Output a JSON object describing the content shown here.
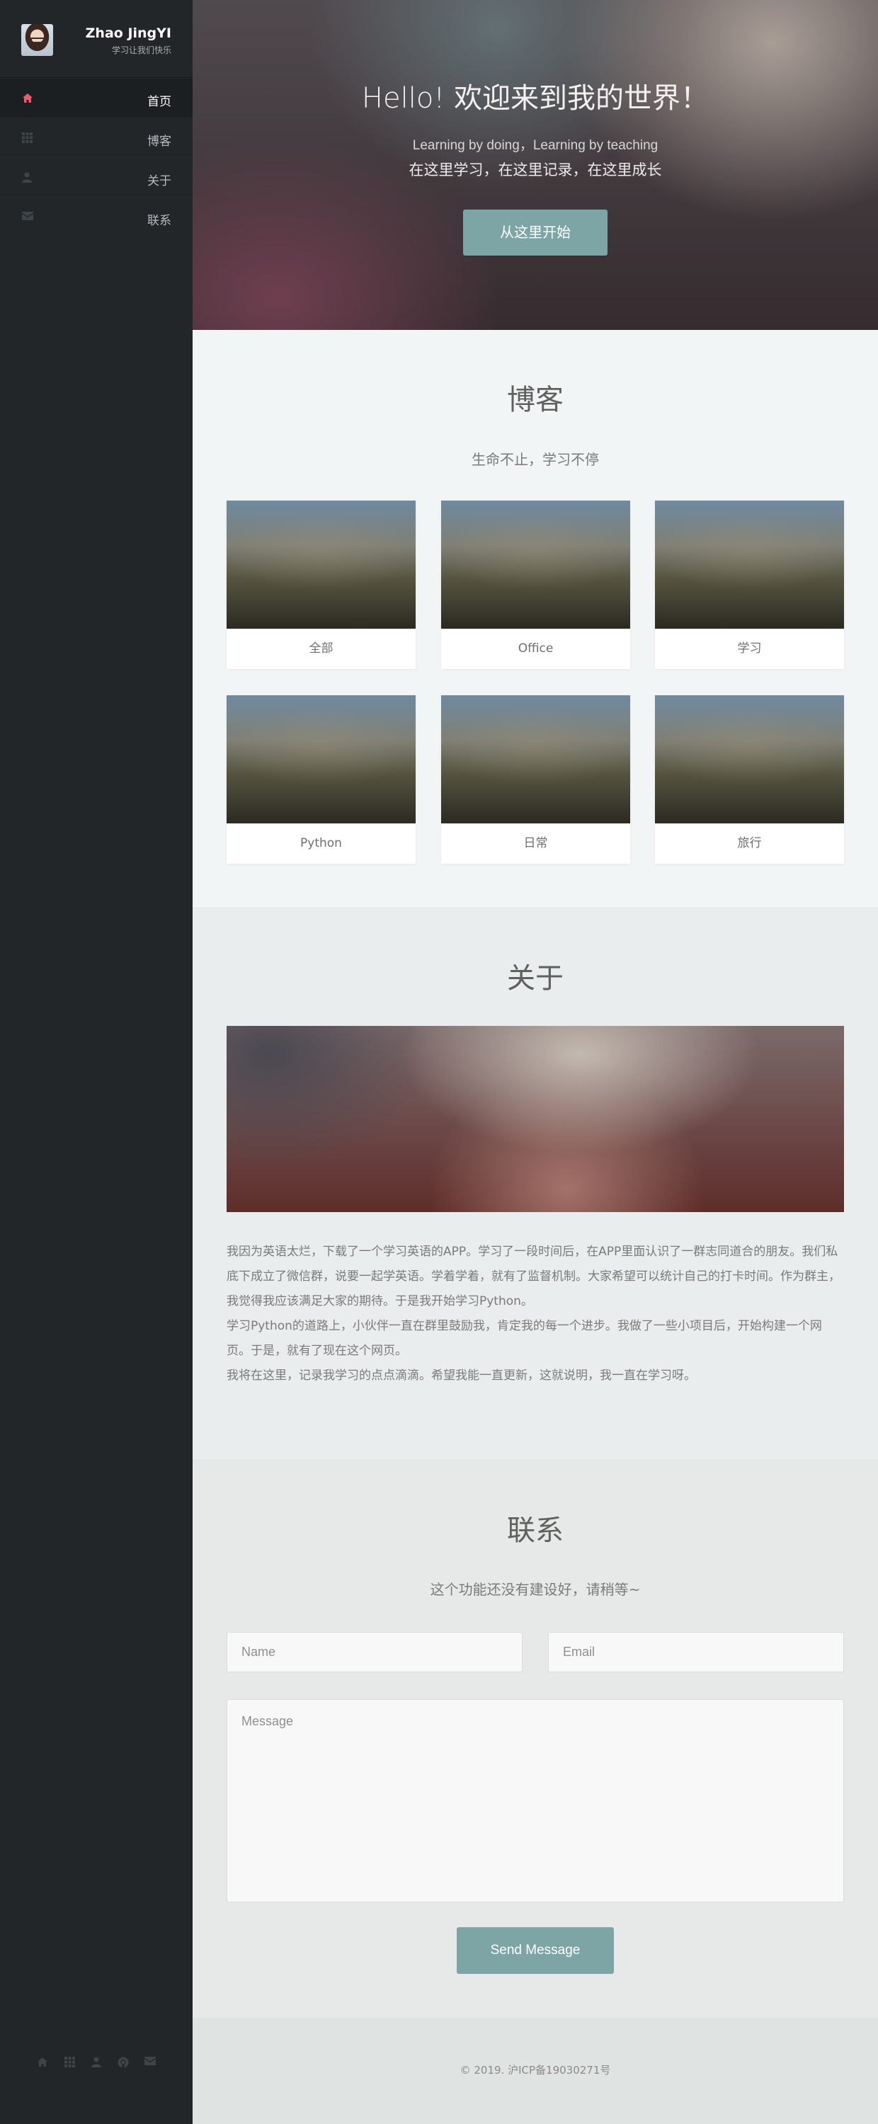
{
  "sidebar": {
    "name": "Zhao JingYI",
    "tagline": "学习让我们快乐",
    "items": [
      {
        "label": "首页",
        "icon": "home-icon",
        "active": true
      },
      {
        "label": "博客",
        "icon": "grid-icon",
        "active": false
      },
      {
        "label": "关于",
        "icon": "user-icon",
        "active": false
      },
      {
        "label": "联系",
        "icon": "envelope-icon",
        "active": false
      }
    ],
    "social": [
      "home-icon",
      "grid-icon",
      "user-icon",
      "github-icon",
      "envelope-icon"
    ]
  },
  "hero": {
    "title_prefix": "Hello!",
    "title_main": "欢迎来到我的世界！",
    "subtitle_en": "Learning by doing，Learning by teaching",
    "subtitle_cn": "在这里学习，在这里记录，在这里成长",
    "button": "从这里开始"
  },
  "blog": {
    "title": "博客",
    "subtitle": "生命不止，学习不停",
    "cards": [
      {
        "label": "全部"
      },
      {
        "label": "Office"
      },
      {
        "label": "学习"
      },
      {
        "label": "Python"
      },
      {
        "label": "日常"
      },
      {
        "label": "旅行"
      }
    ]
  },
  "about": {
    "title": "关于",
    "paragraphs": [
      "我因为英语太烂，下载了一个学习英语的APP。学习了一段时间后，在APP里面认识了一群志同道合的朋友。我们私底下成立了微信群，说要一起学英语。学着学着，就有了监督机制。大家希望可以统计自己的打卡时间。作为群主，我觉得我应该满足大家的期待。于是我开始学习Python。",
      "学习Python的道路上，小伙伴一直在群里鼓励我，肯定我的每一个进步。我做了一些小项目后，开始构建一个网页。于是，就有了现在这个网页。",
      "我将在这里，记录我学习的点点滴滴。希望我能一直更新，这就说明，我一直在学习呀。"
    ]
  },
  "contact": {
    "title": "联系",
    "subtitle": "这个功能还没有建设好，请稍等~",
    "name_placeholder": "Name",
    "email_placeholder": "Email",
    "message_placeholder": "Message",
    "send_label": "Send Message"
  },
  "footer": {
    "text": "© 2019. 沪ICP备19030271号"
  },
  "colors": {
    "sidebar_bg": "#222629",
    "accent": "#7ea5a6",
    "active_icon": "#ea5b6b"
  }
}
